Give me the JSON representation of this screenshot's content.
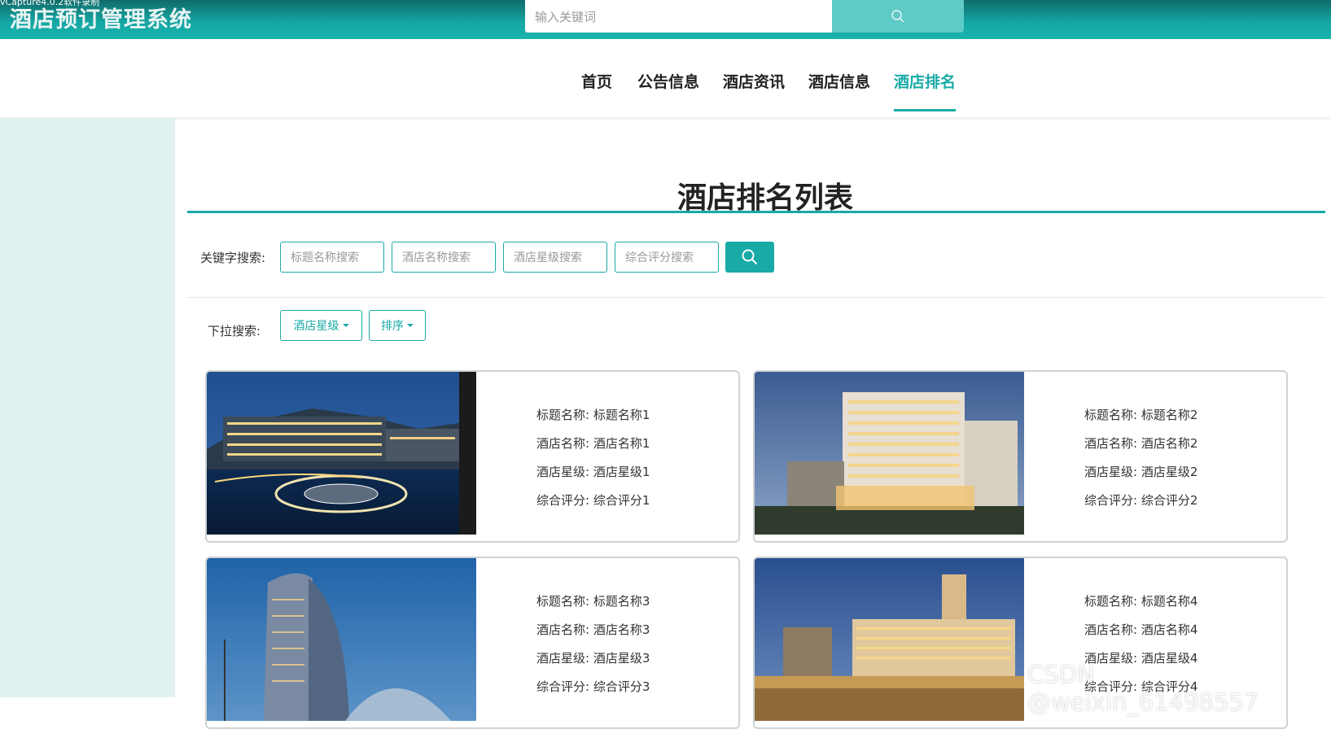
{
  "recorder_text": "vCapture4.0.2软件录制",
  "header": {
    "site_title": "酒店预订管理系统",
    "search_placeholder": "输入关键词"
  },
  "nav": {
    "items": [
      "首页",
      "公告信息",
      "酒店资讯",
      "酒店信息",
      "酒店排名"
    ],
    "active": "酒店排名"
  },
  "page": {
    "title": "酒店排名列表"
  },
  "filters": {
    "keyword_label": "关键字搜索:",
    "inputs": [
      "标题名称搜索",
      "酒店名称搜索",
      "酒店星级搜索",
      "综合评分搜索"
    ],
    "dropdown_label": "下拉搜索:",
    "dropdowns": [
      "酒店星级",
      "排序"
    ]
  },
  "cards": [
    {
      "rows": [
        "标题名称: 标题名称1",
        "酒店名称: 酒店名称1",
        "酒店星级: 酒店星级1",
        "综合评分: 综合评分1"
      ],
      "image": "hotel-resort-night"
    },
    {
      "rows": [
        "标题名称: 标题名称2",
        "酒店名称: 酒店名称2",
        "酒店星级: 酒店星级2",
        "综合评分: 综合评分2"
      ],
      "image": "hotel-tower-dusk"
    },
    {
      "rows": [
        "标题名称: 标题名称3",
        "酒店名称: 酒店名称3",
        "酒店星级: 酒店星级3",
        "综合评分: 综合评分3"
      ],
      "image": "hotel-curved-tower"
    },
    {
      "rows": [
        "标题名称: 标题名称4",
        "酒店名称: 酒店名称4",
        "酒店星级: 酒店星级4",
        "综合评分: 综合评分4"
      ],
      "image": "hotel-venetian"
    }
  ],
  "watermark": "CSDN @weixin_61498557",
  "colors": {
    "accent": "#19aaa6",
    "header_dark": "#0f6b6a",
    "side_panel": "#e1f1f2"
  }
}
